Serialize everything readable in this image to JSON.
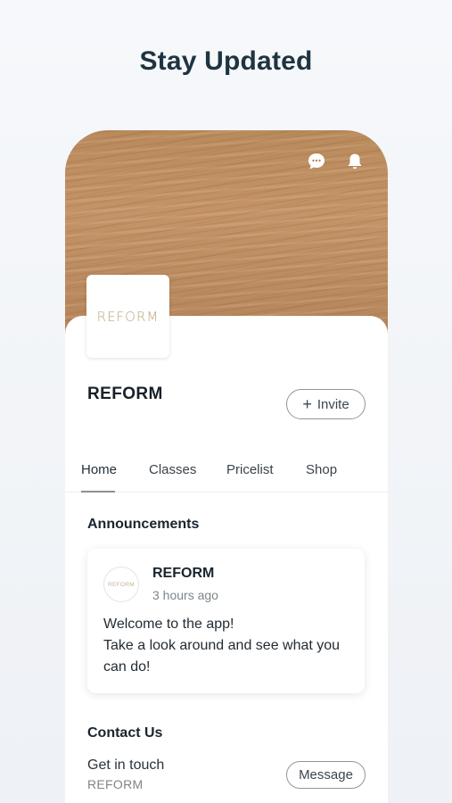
{
  "headline": "Stay Updated",
  "header": {
    "icons": [
      "chat-icon",
      "bell-icon"
    ]
  },
  "profile": {
    "logo_text": "REFORM",
    "name": "REFORM",
    "invite_label": "Invite",
    "invite_icon": "+"
  },
  "tabs": [
    {
      "label": "Home",
      "active": true
    },
    {
      "label": "Classes",
      "active": false
    },
    {
      "label": "Pricelist",
      "active": false
    },
    {
      "label": "Shop",
      "active": false
    }
  ],
  "announcements": {
    "title": "Announcements",
    "post": {
      "avatar_text": "REFORM",
      "author": "REFORM",
      "time": "3 hours ago",
      "line1": "Welcome to the app!",
      "line2": "Take a look around and see what you can do!"
    }
  },
  "contact": {
    "title": "Contact Us",
    "line1": "Get in touch",
    "line2": "REFORM",
    "message_label": "Message"
  },
  "colors": {
    "headline": "#1e3440",
    "wood": "#c49468",
    "logo_gold": "#bba77f"
  }
}
